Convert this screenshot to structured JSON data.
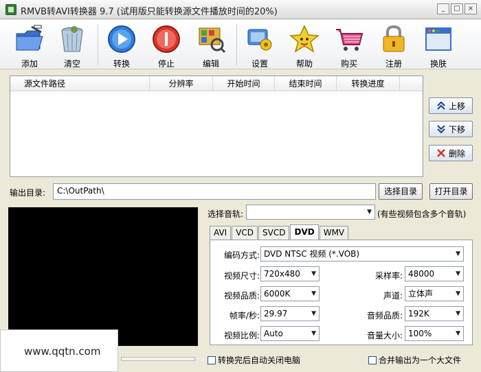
{
  "window": {
    "title": "RMVB转AVI转换器 9.7 (试用版只能转换源文件播放时间的20%)",
    "controls": [
      "_",
      "□",
      "×"
    ]
  },
  "toolbar": [
    {
      "id": "add",
      "label": "添加",
      "icon": "folder-add-icon"
    },
    {
      "id": "clear",
      "label": "清空",
      "icon": "trash-icon"
    },
    {
      "id": "convert",
      "label": "转换",
      "icon": "play-icon"
    },
    {
      "id": "stop",
      "label": "停止",
      "icon": "stop-icon"
    },
    {
      "id": "edit",
      "label": "编辑",
      "icon": "edit-icon"
    },
    {
      "id": "settings",
      "label": "设置",
      "icon": "settings-icon"
    },
    {
      "id": "help",
      "label": "帮助",
      "icon": "star-icon"
    },
    {
      "id": "buy",
      "label": "购买",
      "icon": "cart-icon"
    },
    {
      "id": "register",
      "label": "注册",
      "icon": "lock-icon"
    },
    {
      "id": "skin",
      "label": "换肤",
      "icon": "window-icon"
    }
  ],
  "file_list": {
    "columns": [
      "源文件路径",
      "分辨率",
      "开始时间",
      "结束时间",
      "转换进度"
    ],
    "rows": []
  },
  "side_buttons": {
    "up": "上移",
    "down": "下移",
    "delete": "删除"
  },
  "output": {
    "label": "输出目录:",
    "path": "C:\\OutPath\\",
    "choose_button": "选择目录",
    "open_button": "打开目录"
  },
  "watermark": "www.qqtn.com",
  "audio_track": {
    "label": "选择音轨:",
    "value": "",
    "hint": "(有些视频包含多个音轨)"
  },
  "format_tabs": [
    "AVI",
    "VCD",
    "SVCD",
    "DVD",
    "WMV"
  ],
  "active_tab": "DVD",
  "settings": {
    "codec": {
      "label": "编码方式:",
      "value": "DVD NTSC 视频 (*.VOB)"
    },
    "video_size": {
      "label": "视频尺寸:",
      "value": "720x480"
    },
    "video_quality": {
      "label": "视频品质:",
      "value": "6000K"
    },
    "frame_rate": {
      "label": "帧率/秒:",
      "value": "29.97"
    },
    "aspect_ratio": {
      "label": "视频比例:",
      "value": "Auto"
    },
    "sample_rate": {
      "label": "采样率:",
      "value": "48000"
    },
    "channels": {
      "label": "声道:",
      "value": "立体声"
    },
    "audio_quality": {
      "label": "音频品质:",
      "value": "192K"
    },
    "volume": {
      "label": "音量大小:",
      "value": "100%"
    }
  },
  "options": {
    "shutdown": "转换完后自动关闭电脑",
    "merge": "合并输出为一个大文件"
  }
}
